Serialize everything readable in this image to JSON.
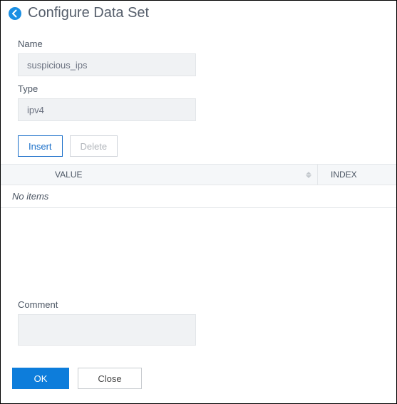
{
  "header": {
    "title": "Configure Data Set"
  },
  "fields": {
    "name_label": "Name",
    "name_value": "suspicious_ips",
    "type_label": "Type",
    "type_value": "ipv4",
    "comment_label": "Comment",
    "comment_value": ""
  },
  "toolbar": {
    "insert_label": "Insert",
    "delete_label": "Delete"
  },
  "table": {
    "columns": {
      "value": "VALUE",
      "index": "INDEX"
    },
    "empty_text": "No items"
  },
  "footer": {
    "ok_label": "OK",
    "close_label": "Close"
  }
}
